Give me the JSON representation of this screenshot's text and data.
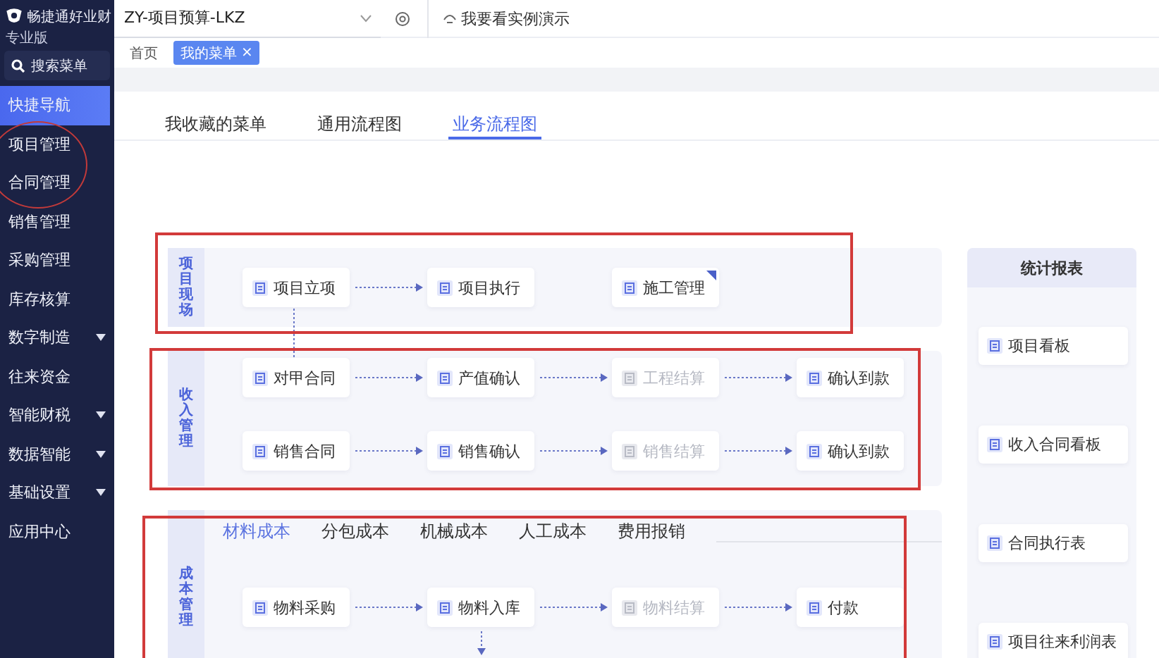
{
  "sidebar": {
    "brand": "畅捷通好业财",
    "edition": "专业版",
    "search": "搜索菜单",
    "items": [
      {
        "label": "快捷导航",
        "selected": true,
        "expandable": false
      },
      {
        "label": "项目管理",
        "selected": false,
        "expandable": false
      },
      {
        "label": "合同管理",
        "selected": false,
        "expandable": false
      },
      {
        "label": "销售管理",
        "selected": false,
        "expandable": false
      },
      {
        "label": "采购管理",
        "selected": false,
        "expandable": false
      },
      {
        "label": "库存核算",
        "selected": false,
        "expandable": false
      },
      {
        "label": "数字制造",
        "selected": false,
        "expandable": true
      },
      {
        "label": "往来资金",
        "selected": false,
        "expandable": false
      },
      {
        "label": "智能财税",
        "selected": false,
        "expandable": true
      },
      {
        "label": "数据智能",
        "selected": false,
        "expandable": true
      },
      {
        "label": "基础设置",
        "selected": false,
        "expandable": true
      },
      {
        "label": "应用中心",
        "selected": false,
        "expandable": false
      }
    ]
  },
  "topbar": {
    "project": "ZY-项目预算-LKZ",
    "demo": "我要看实例演示"
  },
  "page_tabs": [
    {
      "label": "首页",
      "selected": false
    },
    {
      "label": "我的菜单",
      "selected": true,
      "close": "×"
    }
  ],
  "view_tabs": [
    {
      "label": "我收藏的菜单",
      "selected": false
    },
    {
      "label": "通用流程图",
      "selected": false
    },
    {
      "label": "业务流程图",
      "selected": true
    }
  ],
  "lanes": [
    {
      "title": "项目现场",
      "rows": [
        [
          {
            "label": "项目立项",
            "disabled": false,
            "flagged": false,
            "link_down": true
          },
          {
            "label": "项目执行",
            "linked": true,
            "disabled": false,
            "flagged": false
          },
          {
            "label": "施工管理",
            "linked": false,
            "disabled": false,
            "flagged": true
          }
        ]
      ]
    },
    {
      "title": "收入管理",
      "rows": [
        [
          {
            "label": "对甲合同",
            "disabled": false,
            "flagged": false
          },
          {
            "label": "产值确认",
            "linked": true,
            "disabled": false,
            "flagged": false
          },
          {
            "label": "工程结算",
            "linked": true,
            "disabled": true,
            "flagged": false
          },
          {
            "label": "确认到款",
            "linked": true,
            "disabled": false,
            "flagged": false
          }
        ],
        [
          {
            "label": "销售合同",
            "disabled": false,
            "flagged": false
          },
          {
            "label": "销售确认",
            "linked": true,
            "disabled": false,
            "flagged": false
          },
          {
            "label": "销售结算",
            "linked": true,
            "disabled": true,
            "flagged": false
          },
          {
            "label": "确认到款",
            "linked": true,
            "disabled": false,
            "flagged": false
          }
        ]
      ]
    },
    {
      "title": "成本管理",
      "tabs": [
        {
          "label": "材料成本",
          "selected": true
        },
        {
          "label": "分包成本",
          "selected": false
        },
        {
          "label": "机械成本",
          "selected": false
        },
        {
          "label": "人工成本",
          "selected": false
        },
        {
          "label": "费用报销",
          "selected": false
        }
      ],
      "rows": [
        [
          {
            "label": "物料采购",
            "disabled": false,
            "flagged": false
          },
          {
            "label": "物料入库",
            "linked": true,
            "disabled": false,
            "flagged": false,
            "link_down": true
          },
          {
            "label": "物料结算",
            "linked": true,
            "disabled": true,
            "flagged": false
          },
          {
            "label": "付款",
            "linked": true,
            "disabled": false,
            "flagged": false
          }
        ]
      ]
    }
  ],
  "reports": {
    "title": "统计报表",
    "items": [
      "项目看板",
      "收入合同看板",
      "合同执行表",
      "项目往来利润表"
    ]
  }
}
